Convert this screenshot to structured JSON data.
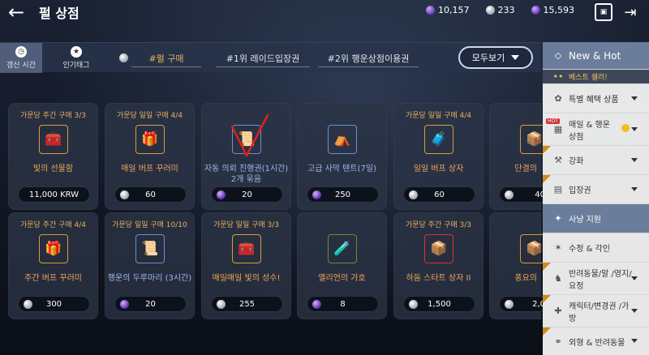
{
  "header": {
    "title": "펄 상점",
    "currencies": [
      {
        "icon": "purple-crystal-icon",
        "value": "10,157"
      },
      {
        "icon": "silver-pearl-icon",
        "value": "233"
      },
      {
        "icon": "violet-energy-icon",
        "value": "15,593"
      }
    ]
  },
  "tabs": {
    "side": [
      {
        "label": "갱신 시간",
        "icon": "clock-icon",
        "active": true
      },
      {
        "label": "인기태그",
        "icon": "star-icon",
        "active": false
      }
    ],
    "filters": [
      "#펄 구매",
      "#1위 레이드입장권",
      "#2위 행운상점이용권"
    ],
    "view_all": "모두보기"
  },
  "products": [
    {
      "limit": "가문당 주간 구매 3/3",
      "name": "빛의 선물함",
      "name_color": "orange",
      "price": "11,000 KRW",
      "currency": "none",
      "thumb": "🧰",
      "frame": "gold"
    },
    {
      "limit": "가문당 일일 구매 4/4",
      "name": "매일 버프 꾸러미",
      "name_color": "orange",
      "price": "60",
      "currency": "silver",
      "thumb": "🎁",
      "frame": "gold"
    },
    {
      "limit": "",
      "name": "자동 의뢰 진행권(1시간) 2개 묶음",
      "name_color": "blue",
      "price": "20",
      "currency": "violet",
      "thumb": "📜",
      "frame": "blue"
    },
    {
      "limit": "",
      "name": "고급 사막 텐트(7일)",
      "name_color": "blue",
      "price": "250",
      "currency": "violet",
      "thumb": "⛺",
      "frame": "blue"
    },
    {
      "limit": "가문당 일일 구매 4/4",
      "name": "일일 버프 상자",
      "name_color": "orange",
      "price": "60",
      "currency": "silver",
      "thumb": "🧳",
      "frame": "gold"
    },
    {
      "limit": "",
      "name": "단결의",
      "name_color": "orange",
      "price": "40",
      "currency": "silver",
      "thumb": "📦",
      "frame": "gold"
    },
    {
      "limit": "가문당 주간 구매 4/4",
      "name": "주간 버프 꾸러미",
      "name_color": "orange",
      "price": "300",
      "currency": "silver",
      "thumb": "🎁",
      "frame": "gold"
    },
    {
      "limit": "가문당 일일 구매 10/10",
      "name": "행운의 두루마리 (3시간)",
      "name_color": "blue",
      "price": "20",
      "currency": "violet",
      "thumb": "📜",
      "frame": "blue"
    },
    {
      "limit": "가문당 일일 구매 3/3",
      "name": "매일매일 빛의 성수!",
      "name_color": "orange",
      "price": "255",
      "currency": "silver",
      "thumb": "🧰",
      "frame": "gold"
    },
    {
      "limit": "",
      "name": "엘리언의 가호",
      "name_color": "orange",
      "price": "8",
      "currency": "violet",
      "thumb": "🧪",
      "frame": "green"
    },
    {
      "limit": "가문당 주간 구매 3/3",
      "name": "하둠 스타트 상자 II",
      "name_color": "orange",
      "price": "1,500",
      "currency": "silver",
      "thumb": "📦",
      "frame": "red"
    },
    {
      "limit": "",
      "name": "풍요의",
      "name_color": "orange",
      "price": "2,0",
      "currency": "silver",
      "thumb": "📦",
      "frame": "gold"
    }
  ],
  "sidebar": [
    {
      "label": "New & Hot",
      "icon": "diamond-icon"
    },
    {
      "label": "베스트 셀러!",
      "icon": ""
    },
    {
      "label": "특별 혜택 상품",
      "icon": "gift-icon"
    },
    {
      "label": "매일 & 행운 상점",
      "icon": "calendar-icon"
    },
    {
      "label": "강화",
      "icon": "hammer-icon"
    },
    {
      "label": "입장권",
      "icon": "ticket-icon"
    },
    {
      "label": "사냥 지원",
      "icon": "crosshair-icon"
    },
    {
      "label": "수정 & 각인",
      "icon": "gem-icon"
    },
    {
      "label": "반려동물/말 /영지/요정",
      "icon": "horse-icon"
    },
    {
      "label": "캐릭터/변경권 /가방",
      "icon": "plus-icon"
    },
    {
      "label": "외형 & 반려동물",
      "icon": "mask-icon"
    }
  ]
}
